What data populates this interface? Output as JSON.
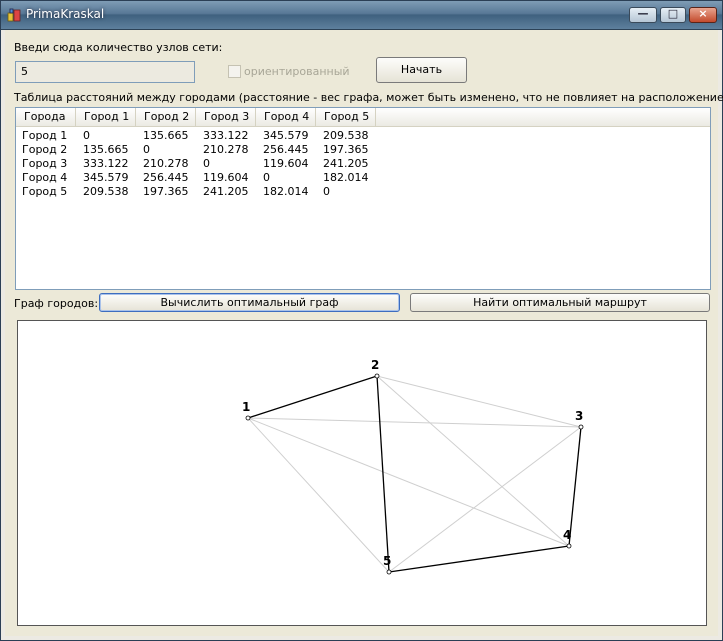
{
  "window": {
    "title": "PrimaKraskal",
    "minimize": "—",
    "maximize": "□",
    "close": "×"
  },
  "form": {
    "nodes_label": "Введи сюда количество узлов сети:",
    "nodes_value": "5",
    "oriented_label": "ориентированный",
    "start_button": "Начать",
    "table_label": "Таблица расстояний между городами (расстояние - вес графа, может быть изменено, что не повлияет на расположение):",
    "graph_label": "Граф городов:",
    "compute_button": "Вычислить оптимальный граф",
    "route_button": "Найти оптимальный маршрут"
  },
  "table": {
    "columns": [
      "Города",
      "Город 1",
      "Город 2",
      "Город 3",
      "Город 4",
      "Город 5"
    ],
    "rows": [
      [
        "Город 1",
        "0",
        "135.665",
        "333.122",
        "345.579",
        "209.538"
      ],
      [
        "Город 2",
        "135.665",
        "0",
        "210.278",
        "256.445",
        "197.365"
      ],
      [
        "Город 3",
        "333.122",
        "210.278",
        "0",
        "119.604",
        "241.205"
      ],
      [
        "Город 4",
        "345.579",
        "256.445",
        "119.604",
        "0",
        "182.014"
      ],
      [
        "Город 5",
        "209.538",
        "197.365",
        "241.205",
        "182.014",
        "0"
      ]
    ]
  },
  "graph": {
    "nodes": [
      {
        "id": "1",
        "label": "1"
      },
      {
        "id": "2",
        "label": "2"
      },
      {
        "id": "3",
        "label": "3"
      },
      {
        "id": "4",
        "label": "4"
      },
      {
        "id": "5",
        "label": "5"
      }
    ],
    "optimal_edges": [
      [
        "1",
        "2"
      ],
      [
        "2",
        "5"
      ],
      [
        "5",
        "4"
      ],
      [
        "4",
        "3"
      ]
    ],
    "all_edges": [
      [
        "1",
        "2"
      ],
      [
        "1",
        "3"
      ],
      [
        "1",
        "4"
      ],
      [
        "1",
        "5"
      ],
      [
        "2",
        "3"
      ],
      [
        "2",
        "4"
      ],
      [
        "2",
        "5"
      ],
      [
        "3",
        "4"
      ],
      [
        "3",
        "5"
      ],
      [
        "4",
        "5"
      ]
    ]
  },
  "colors": {
    "optimal_edge": "#000000",
    "other_edge": "#cfcfcf",
    "titlebar": "#587896"
  }
}
